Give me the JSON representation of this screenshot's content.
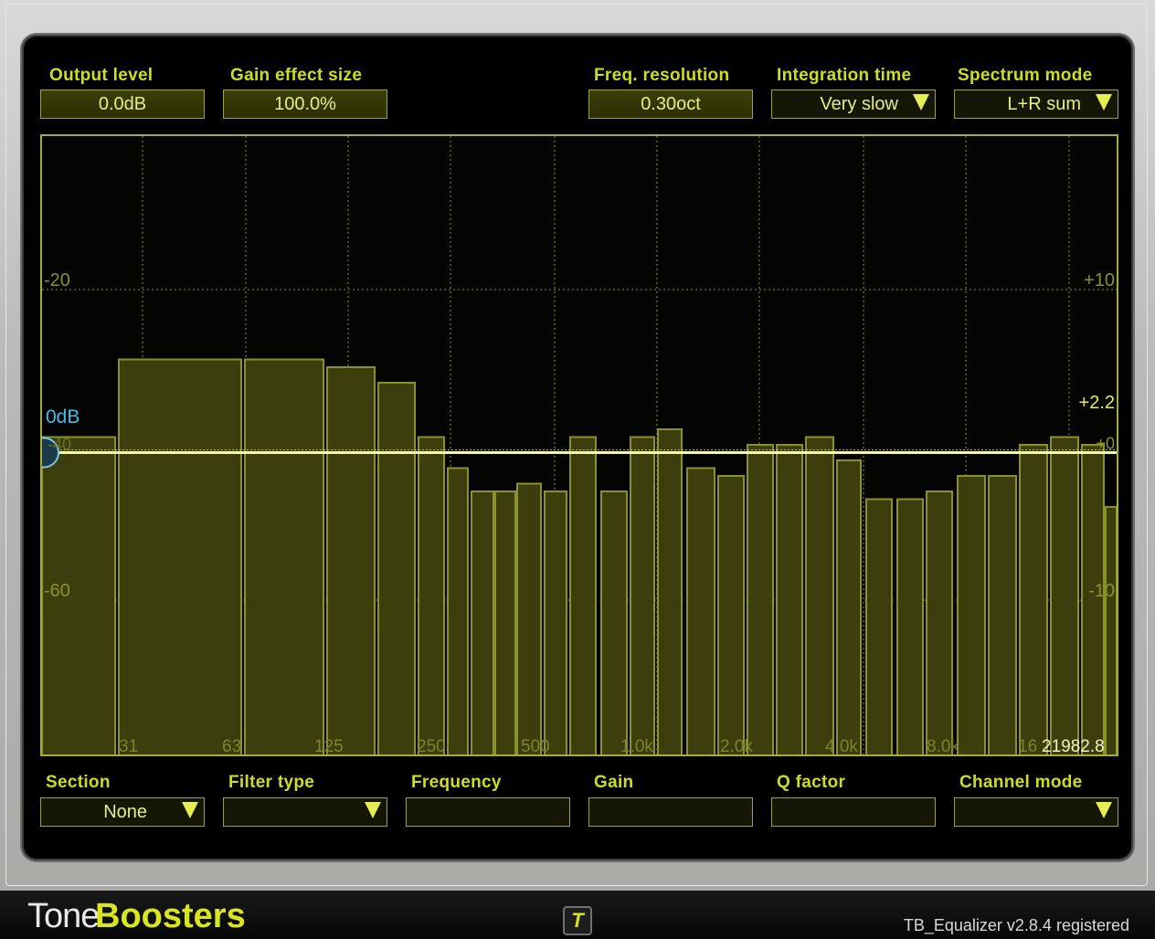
{
  "top_controls": {
    "output_level": {
      "label": "Output level",
      "value": "0.0dB"
    },
    "gain_effect_size": {
      "label": "Gain effect size",
      "value": "100.0%"
    },
    "freq_resolution": {
      "label": "Freq. resolution",
      "value": "0.30oct"
    },
    "integration_time": {
      "label": "Integration time",
      "value": "Very slow"
    },
    "spectrum_mode": {
      "label": "Spectrum mode",
      "value": "L+R sum"
    }
  },
  "spectrum": {
    "left_axis_labels": [
      "-20",
      "-60"
    ],
    "right_axis_labels": [
      "+10",
      "+2.2",
      "+0",
      "-10"
    ],
    "zero_db_label": "0dB",
    "left_marker_label": "-40",
    "frequency_labels": [
      "31",
      "63",
      "125",
      "250",
      "500",
      "1.0k",
      "2.0k",
      "4.0k",
      "8.0k",
      "16",
      "21982.8"
    ],
    "bars_db": [
      -39,
      -29,
      -29,
      -30,
      -32,
      -39,
      -43,
      -46,
      -46,
      -45,
      -46,
      -39,
      -46,
      -39,
      -38,
      -43,
      -44,
      -40,
      -40,
      -39,
      -42,
      -47,
      -47,
      -46,
      -44,
      -44,
      -40,
      -39,
      -40,
      -48
    ],
    "eq_line_gain": 0,
    "colors": {
      "accent": "#ccdd22",
      "bar_fill": "#3d3e0e",
      "bar_stroke": "#8a9226",
      "eq_line": "#f4f8b0",
      "zero_label": "#44bbee",
      "bg": "#040402"
    }
  },
  "bottom_controls": {
    "section": {
      "label": "Section",
      "value": "None"
    },
    "filter_type": {
      "label": "Filter type",
      "value": ""
    },
    "frequency": {
      "label": "Frequency",
      "value": ""
    },
    "gain": {
      "label": "Gain",
      "value": ""
    },
    "q_factor": {
      "label": "Q factor",
      "value": ""
    },
    "channel_mode": {
      "label": "Channel mode",
      "value": ""
    }
  },
  "footer": {
    "logo_tone": "Tone",
    "logo_boosters": "Boosters",
    "badge": "T",
    "version": "TB_Equalizer v2.8.4 registered"
  }
}
